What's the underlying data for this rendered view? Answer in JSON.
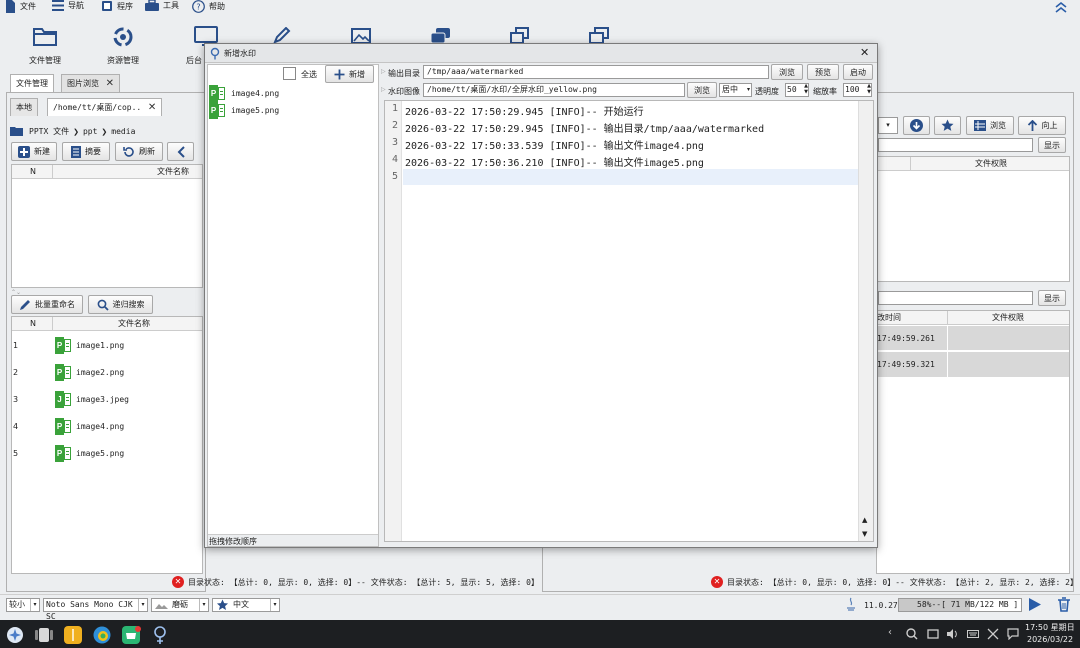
{
  "menubar": {
    "items": [
      {
        "label": "文件",
        "icon": "file-icon"
      },
      {
        "label": "导航",
        "icon": "hamburger-icon"
      },
      {
        "label": "程序",
        "icon": "program-icon"
      },
      {
        "label": "工具",
        "icon": "toolbox-icon"
      },
      {
        "label": "帮助",
        "icon": "help-icon"
      }
    ]
  },
  "toolbar": {
    "buttons": [
      {
        "label": "文件管理",
        "icon": "folder-icon"
      },
      {
        "label": "资源管理",
        "icon": "puzzle-icon"
      },
      {
        "label": "后台",
        "icon": "monitor-icon"
      }
    ]
  },
  "left": {
    "tabs": [
      {
        "label": "文件管理"
      },
      {
        "label": "图片浏览"
      }
    ],
    "subtabs": [
      {
        "label": "本地"
      },
      {
        "label": "/home/tt/桌面/cop.."
      }
    ],
    "breadcrumb": [
      "PPTX 文件",
      "ppt",
      "media"
    ],
    "actions": {
      "new": "新建",
      "summary": "摘要",
      "refresh": "刷新"
    },
    "top_headers": {
      "n": "N",
      "name": "文件名称"
    },
    "bottom_actions": {
      "rename": "批量重命名",
      "search": "递归搜索"
    },
    "bottom_headers": {
      "n": "N",
      "name": "文件名称"
    },
    "files": [
      {
        "n": "1",
        "name": "image1.png",
        "type": "P"
      },
      {
        "n": "2",
        "name": "image2.png",
        "type": "P"
      },
      {
        "n": "3",
        "name": "image3.jpeg",
        "type": "J"
      },
      {
        "n": "4",
        "name": "image4.png",
        "type": "P"
      },
      {
        "n": "5",
        "name": "image5.png",
        "type": "P"
      }
    ],
    "status": "目录状态: 【总计: 0, 显示: 0, 选择: 0】-- 文件状态: 【总计: 5, 显示: 5, 选择: 0】"
  },
  "right": {
    "actions": {
      "browse": "浏览",
      "up": "向上",
      "show": "显示"
    },
    "top_headers": {
      "perm": "文件权限"
    },
    "bottom_headers": {
      "mtime": "改时间",
      "perm": "文件权限"
    },
    "rows": [
      {
        "mtime": "17:49:59.261",
        "perm": ""
      },
      {
        "mtime": "17:49:59.321",
        "perm": ""
      }
    ],
    "status": "目录状态: 【总计: 0, 显示: 0, 选择: 0】-- 文件状态: 【总计: 2, 显示: 2, 选择: 2】"
  },
  "dialog": {
    "title": "新增水印",
    "select_all": "全选",
    "add": "新增",
    "files": [
      {
        "name": "image4.png"
      },
      {
        "name": "image5.png"
      }
    ],
    "footer_hint": "拖拽修改顺序",
    "output_label": "输出目录",
    "output_value": "/tmp/aaa/watermarked",
    "browse": "浏览",
    "preview": "预览",
    "start": "启动",
    "wm_label": "水印图像",
    "wm_value": "/home/tt/桌面/水印/全屏水印_yellow.png",
    "browse2": "浏览",
    "align": "居中",
    "opacity_label": "透明度",
    "opacity_value": "50",
    "scale_label": "缩放率",
    "scale_value": "100",
    "log": [
      {
        "n": "1",
        "text": "2026-03-22 17:50:29.945 [INFO]-- 开始运行"
      },
      {
        "n": "2",
        "text": "2026-03-22 17:50:29.945 [INFO]-- 输出目录/tmp/aaa/watermarked"
      },
      {
        "n": "3",
        "text": "2026-03-22 17:50:33.539 [INFO]-- 输出文件image4.png"
      },
      {
        "n": "4",
        "text": "2026-03-22 17:50:36.210 [INFO]-- 输出文件image5.png"
      },
      {
        "n": "5",
        "text": ""
      }
    ]
  },
  "bottombar": {
    "size": "较小",
    "font": "Noto Sans Mono CJK SC",
    "theme": "磨砺",
    "lang": "中文",
    "version": "11.0.27",
    "memory": "58%--[ 71 MB/122 MB ]"
  },
  "taskbar": {
    "time": "17:50 星期日",
    "date": "2026/03/22"
  },
  "colors": {
    "accent": "#2a5da8",
    "green": "#3aa23a",
    "error": "#e02020"
  }
}
